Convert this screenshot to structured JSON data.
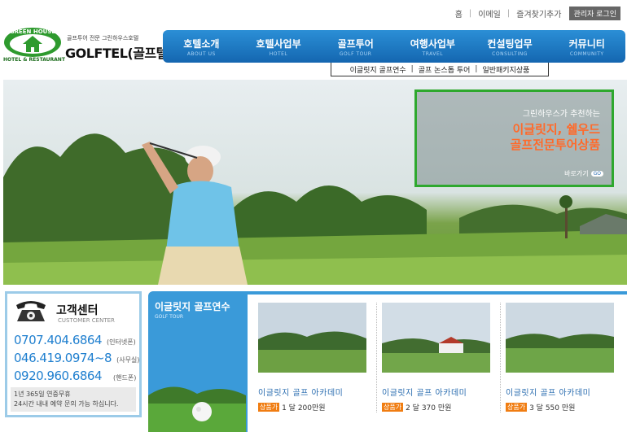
{
  "util": {
    "home": "홈",
    "email": "이메일",
    "bookmark": "즐겨찾기추가",
    "admin": "관리자 로그인"
  },
  "logo": {
    "emblem_text": "GREEN HOUSE",
    "tagline": "골프투어 전문 그린하우스호텔",
    "brand": "GOLFTEL(골프텔)",
    "hotel": "HOTEL & RESTAURANT"
  },
  "nav": [
    {
      "ko": "호텔소개",
      "en": "ABOUT US"
    },
    {
      "ko": "호텔사업부",
      "en": "HOTEL"
    },
    {
      "ko": "골프투어",
      "en": "GOLF TOUR"
    },
    {
      "ko": "여행사업부",
      "en": "TRAVEL"
    },
    {
      "ko": "컨설팅업무",
      "en": "CONSULTING"
    },
    {
      "ko": "커뮤니티",
      "en": "COMMUNITY"
    }
  ],
  "subnav": [
    "이글릿지 골프연수",
    "골프 논스톱 투어",
    "일반패키지상품"
  ],
  "promo": {
    "line1": "그린하우스가 추천하는",
    "line2": "이글릿지, 쉘우드",
    "line3": "골프전문투어상품",
    "go": "바로가기",
    "go_badge": "GO"
  },
  "customer_center": {
    "title": "고객센터",
    "subtitle": "CUSTOMER CENTER",
    "phones": [
      {
        "number": "0707.404.6864",
        "tag": "(인터넷폰)"
      },
      {
        "number": "046.419.0974~8",
        "tag": "(사무실)"
      },
      {
        "number": "0920.960.6864",
        "tag": "(핸드폰)"
      }
    ],
    "note1": "1년 365일 연중무휴",
    "note2": "24시간 내내 예약 문의 가능 하십니다."
  },
  "training": {
    "title": "이글릿지 골프연수",
    "title_en": "GOLF TOUR",
    "cards": [
      {
        "name": "이글릿지 골프 아카데미",
        "flag": "상품가",
        "price": "1 달 200만원"
      },
      {
        "name": "이글릿지 골프 아카데미",
        "flag": "상품가",
        "price": "2 달 370 만원"
      },
      {
        "name": "이글릿지 골프 아카데미",
        "flag": "상품가",
        "price": "3 달 550 만원"
      }
    ]
  },
  "colors": {
    "nav_blue": "#1f78c4",
    "promo_green": "#2ea82e",
    "promo_orange": "#ff6a2a",
    "phone_blue": "#1f7fcf",
    "price_flag": "#f07d12"
  }
}
